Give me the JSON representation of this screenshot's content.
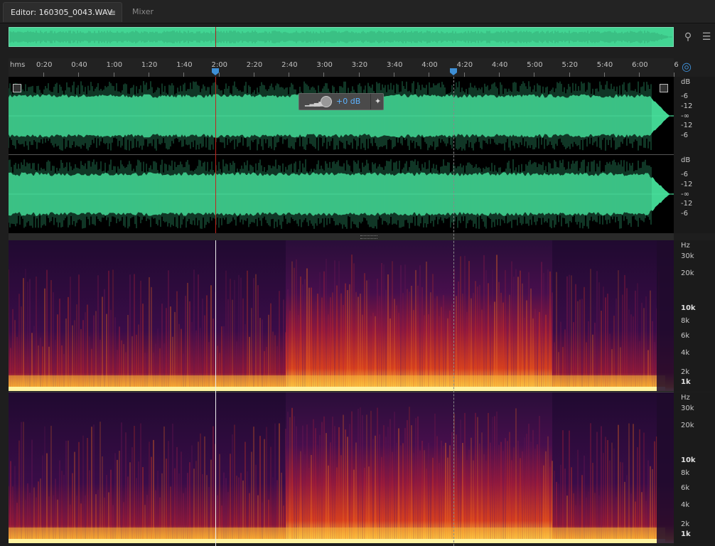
{
  "tabs": {
    "editor_label": "Editor: 160305_0043.WAV *",
    "editor_menu": "≡",
    "mixer_label": "Mixer"
  },
  "ruler": {
    "unit": "hms",
    "ticks": [
      "0:20",
      "0:40",
      "1:00",
      "1:20",
      "1:40",
      "2:00",
      "2:20",
      "2:40",
      "3:00",
      "3:20",
      "3:40",
      "4:00",
      "4:20",
      "4:40",
      "5:00",
      "5:20",
      "5:40",
      "6:00",
      "6"
    ]
  },
  "hud": {
    "gain": "+0 dB"
  },
  "db_scale": {
    "unit": "dB",
    "labels": [
      "-6",
      "-12",
      "-∞",
      "-12",
      "-6"
    ]
  },
  "hz_scale": {
    "unit": "Hz",
    "labels": [
      "30k",
      "20k",
      "10k",
      "8k",
      "6k",
      "4k",
      "2k",
      "1k"
    ]
  },
  "colors": {
    "waveform": "#42d593",
    "cursor": "#c0241e",
    "playhead_marker": "#3e8fd6"
  },
  "icons": [
    "zoom-icon",
    "list-icon",
    "headphones-icon",
    "hud-pin-icon",
    "level-bars-icon",
    "gain-knob-icon",
    "expand-icon",
    "resize-icon"
  ]
}
